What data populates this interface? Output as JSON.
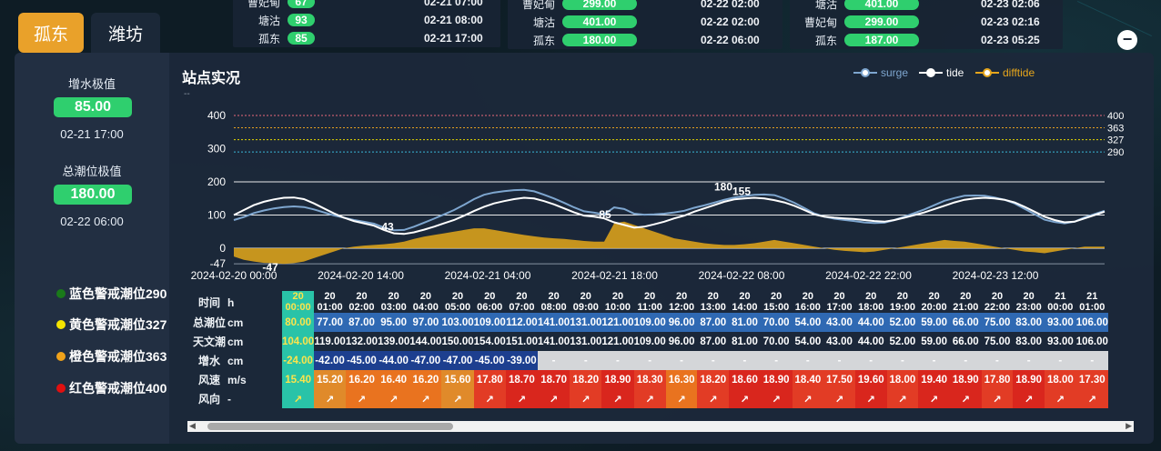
{
  "top_cards": [
    {
      "rows": [
        {
          "name": "曹妃甸",
          "value": "67",
          "time": "02-21 07:00"
        },
        {
          "name": "塘沽",
          "value": "93",
          "time": "02-21 08:00"
        },
        {
          "name": "孤东",
          "value": "85",
          "time": "02-21 17:00"
        }
      ]
    },
    {
      "rows": [
        {
          "name": "曹妃甸",
          "value": "299.00",
          "time": "02-22 02:00"
        },
        {
          "name": "塘沽",
          "value": "401.00",
          "time": "02-22 02:00"
        },
        {
          "name": "孤东",
          "value": "180.00",
          "time": "02-22 06:00"
        }
      ]
    },
    {
      "rows": [
        {
          "name": "塘沽",
          "value": "401.00",
          "time": "02-23 02:06"
        },
        {
          "name": "曹妃甸",
          "value": "299.00",
          "time": "02-23 02:16"
        },
        {
          "name": "孤东",
          "value": "187.00",
          "time": "02-23 05:25"
        }
      ]
    }
  ],
  "tabs": [
    "孤东",
    "潍坊"
  ],
  "left": {
    "surge_label": "增水极值",
    "surge_value": "85.00",
    "surge_time": "02-21 17:00",
    "tide_label": "总潮位极值",
    "tide_value": "180.00",
    "tide_time": "02-22 06:00",
    "warnings": [
      {
        "label": "蓝色警戒潮位",
        "value": "290",
        "color": "#1a7a1a"
      },
      {
        "label": "黄色警戒潮位",
        "value": "327",
        "color": "#f5e400"
      },
      {
        "label": "橙色警戒潮位",
        "value": "363",
        "color": "#f0a21a"
      },
      {
        "label": "红色警戒潮位",
        "value": "400",
        "color": "#e01010"
      }
    ]
  },
  "chart_title": "站点实况",
  "chart_sub": "--",
  "chart_data": {
    "type": "line",
    "legend": [
      "surge",
      "tide",
      "difftide"
    ],
    "y_ticks": [
      400,
      300,
      200,
      100,
      0,
      -47
    ],
    "right_labels": [
      "400",
      "363",
      "327",
      "290"
    ],
    "x_labels": [
      "2024-02-20 00:00",
      "2024-02-20 14:00",
      "2024-02-21 04:00",
      "2024-02-21 18:00",
      "2024-02-22 08:00",
      "2024-02-22 22:00",
      "2024-02-23 12:00"
    ],
    "annotations": [
      "-47",
      "43",
      "85",
      "180",
      "155"
    ],
    "colors": {
      "surge": "#7ea6cf",
      "tide": "#ffffff",
      "difftide": "#e6a61c"
    }
  },
  "table": {
    "labels": {
      "time": "时间",
      "time_unit": "h",
      "total": "总潮位",
      "total_unit": "cm",
      "astro": "天文潮",
      "astro_unit": "cm",
      "surge": "增水",
      "surge_unit": "cm",
      "wind": "风速",
      "wind_unit": "m/s",
      "dir": "风向",
      "dir_unit": "-"
    },
    "times": [
      [
        "20",
        "00:00"
      ],
      [
        "20",
        "01:00"
      ],
      [
        "20",
        "02:00"
      ],
      [
        "20",
        "03:00"
      ],
      [
        "20",
        "04:00"
      ],
      [
        "20",
        "05:00"
      ],
      [
        "20",
        "06:00"
      ],
      [
        "20",
        "07:00"
      ],
      [
        "20",
        "08:00"
      ],
      [
        "20",
        "09:00"
      ],
      [
        "20",
        "10:00"
      ],
      [
        "20",
        "11:00"
      ],
      [
        "20",
        "12:00"
      ],
      [
        "20",
        "13:00"
      ],
      [
        "20",
        "14:00"
      ],
      [
        "20",
        "15:00"
      ],
      [
        "20",
        "16:00"
      ],
      [
        "20",
        "17:00"
      ],
      [
        "20",
        "18:00"
      ],
      [
        "20",
        "19:00"
      ],
      [
        "20",
        "20:00"
      ],
      [
        "20",
        "21:00"
      ],
      [
        "20",
        "22:00"
      ],
      [
        "20",
        "23:00"
      ],
      [
        "21",
        "00:00"
      ],
      [
        "21",
        "01:00"
      ]
    ],
    "total": [
      "80.00",
      "77.00",
      "87.00",
      "95.00",
      "97.00",
      "103.00",
      "109.00",
      "112.00",
      "141.00",
      "131.00",
      "121.00",
      "109.00",
      "96.00",
      "87.00",
      "81.00",
      "70.00",
      "54.00",
      "43.00",
      "44.00",
      "52.00",
      "59.00",
      "66.00",
      "75.00",
      "83.00",
      "93.00",
      "106.00"
    ],
    "astro": [
      "104.00",
      "119.00",
      "132.00",
      "139.00",
      "144.00",
      "150.00",
      "154.00",
      "151.00",
      "141.00",
      "131.00",
      "121.00",
      "109.00",
      "96.00",
      "87.00",
      "81.00",
      "70.00",
      "54.00",
      "43.00",
      "44.00",
      "52.00",
      "59.00",
      "66.00",
      "75.00",
      "83.00",
      "93.00",
      "106.00"
    ],
    "surge": [
      "-24.00",
      "-42.00",
      "-45.00",
      "-44.00",
      "-47.00",
      "-47.00",
      "-45.00",
      "-39.00",
      "-",
      "-",
      "-",
      "-",
      "-",
      "-",
      "-",
      "-",
      "-",
      "-",
      "-",
      "-",
      "-",
      "-",
      "-",
      "-",
      "-",
      "-"
    ],
    "wind": [
      "15.40",
      "15.20",
      "16.20",
      "16.40",
      "16.20",
      "15.60",
      "17.80",
      "18.70",
      "18.70",
      "18.20",
      "18.90",
      "18.30",
      "16.30",
      "18.20",
      "18.60",
      "18.90",
      "18.40",
      "17.50",
      "19.60",
      "18.00",
      "19.40",
      "18.90",
      "17.80",
      "18.90",
      "18.00",
      "17.30"
    ],
    "dir_glyph": "↗"
  }
}
